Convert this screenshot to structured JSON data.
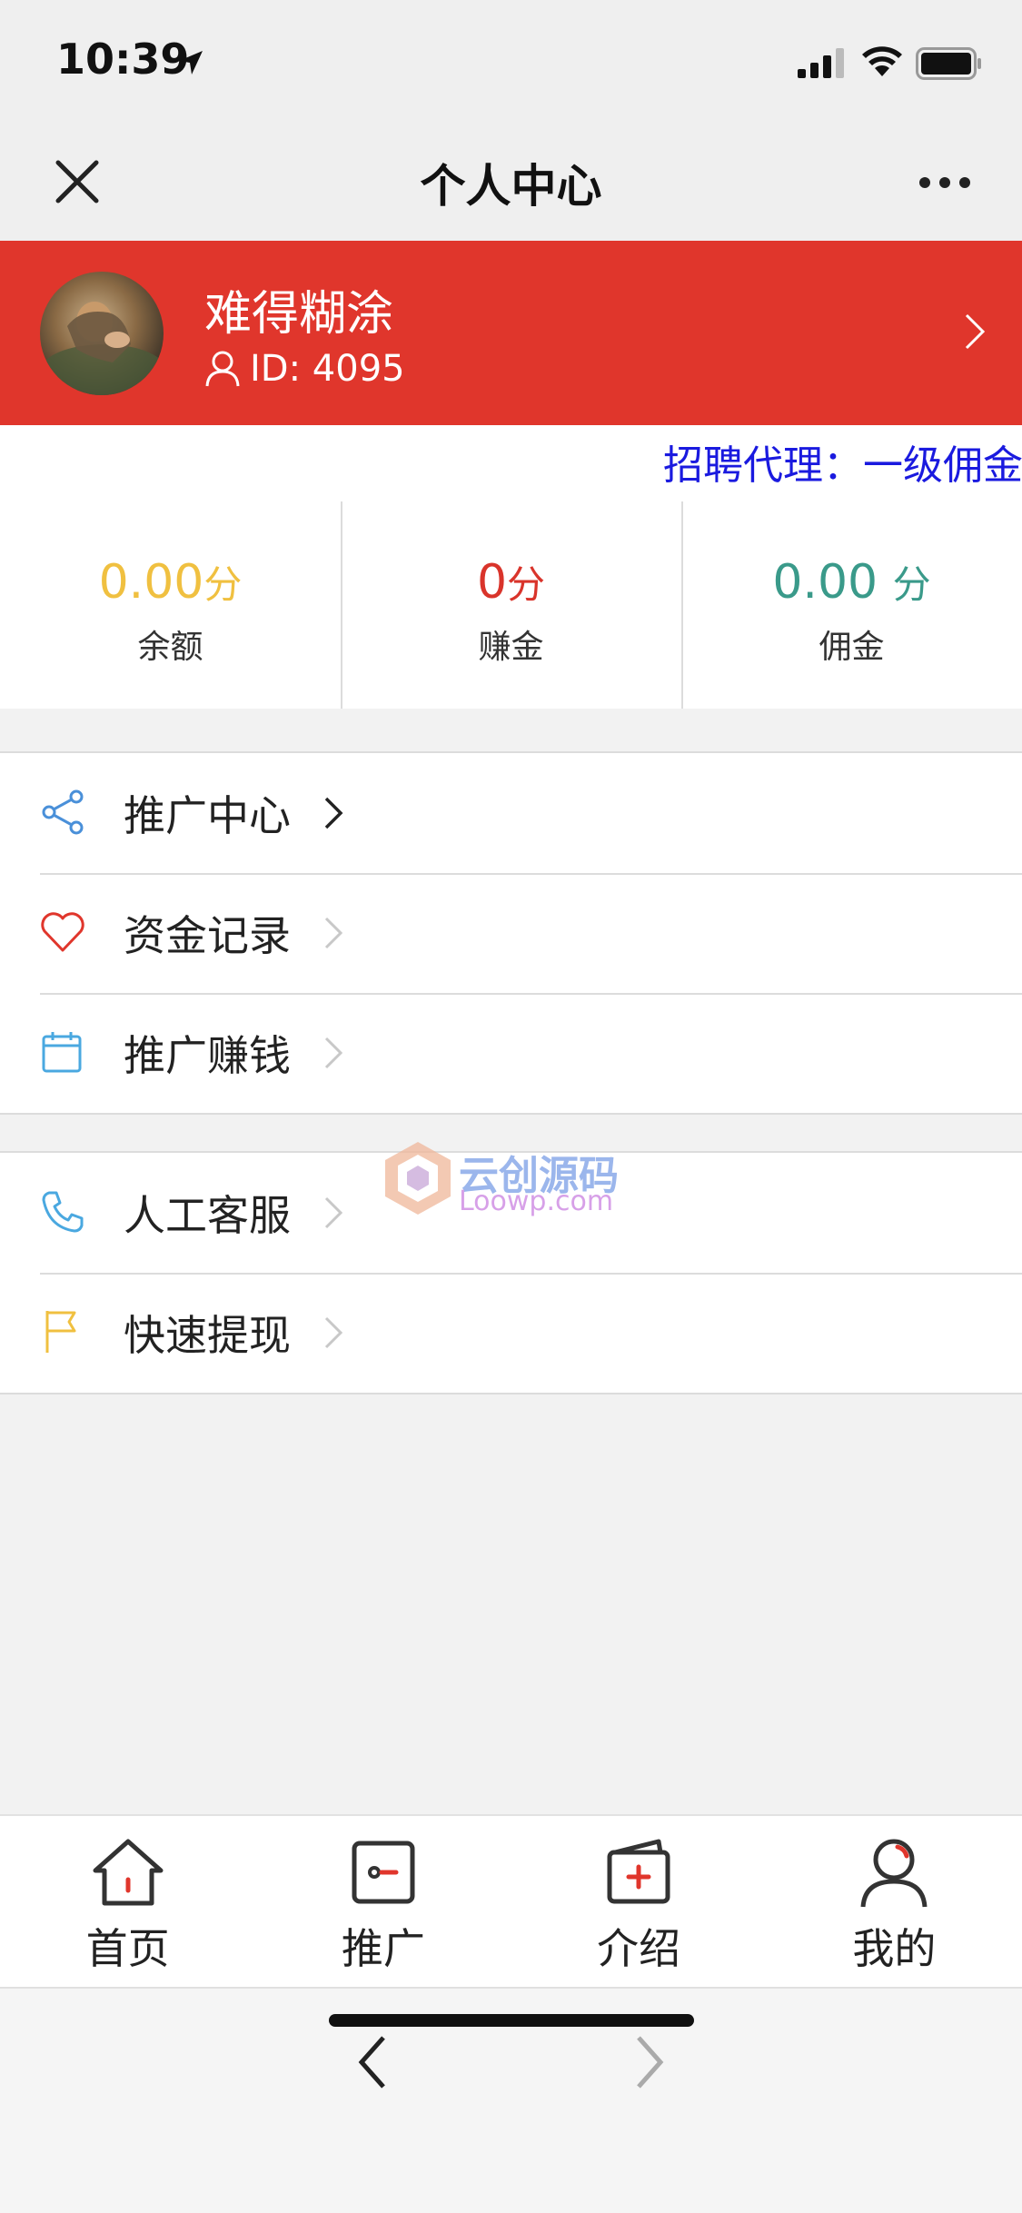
{
  "status": {
    "time": "10:39"
  },
  "nav": {
    "title": "个人中心"
  },
  "profile": {
    "name": "难得糊涂",
    "id": "ID: 4095"
  },
  "marquee": {
    "text": "招聘代理：一级佣金"
  },
  "stats": [
    {
      "value": "0.00",
      "unit": "分",
      "label": "余额",
      "color": "#f0c040"
    },
    {
      "value": "0",
      "unit": "分",
      "label": "赚金",
      "color": "#d9342b"
    },
    {
      "value": "0.00 ",
      "unit": "分",
      "label": "佣金",
      "color": "#3a9a8a"
    }
  ],
  "menu_group_1": [
    {
      "label": "推广中心",
      "icon": "share-icon",
      "color": "#4a90d9"
    },
    {
      "label": "资金记录",
      "icon": "heart-icon",
      "color": "#e0362c"
    },
    {
      "label": "推广赚钱",
      "icon": "calendar-icon",
      "color": "#4aa8e0"
    }
  ],
  "menu_group_2": [
    {
      "label": "人工客服",
      "icon": "phone-icon",
      "color": "#4aa8e0"
    },
    {
      "label": "快速提现",
      "icon": "flag-icon",
      "color": "#f0c040"
    }
  ],
  "watermark": {
    "line1": "云创源码",
    "line2": "Loowp.com"
  },
  "tabs": [
    {
      "label": "首页",
      "icon": "home-icon"
    },
    {
      "label": "推广",
      "icon": "promote-icon"
    },
    {
      "label": "介绍",
      "icon": "intro-icon"
    },
    {
      "label": "我的",
      "icon": "user-icon"
    }
  ]
}
